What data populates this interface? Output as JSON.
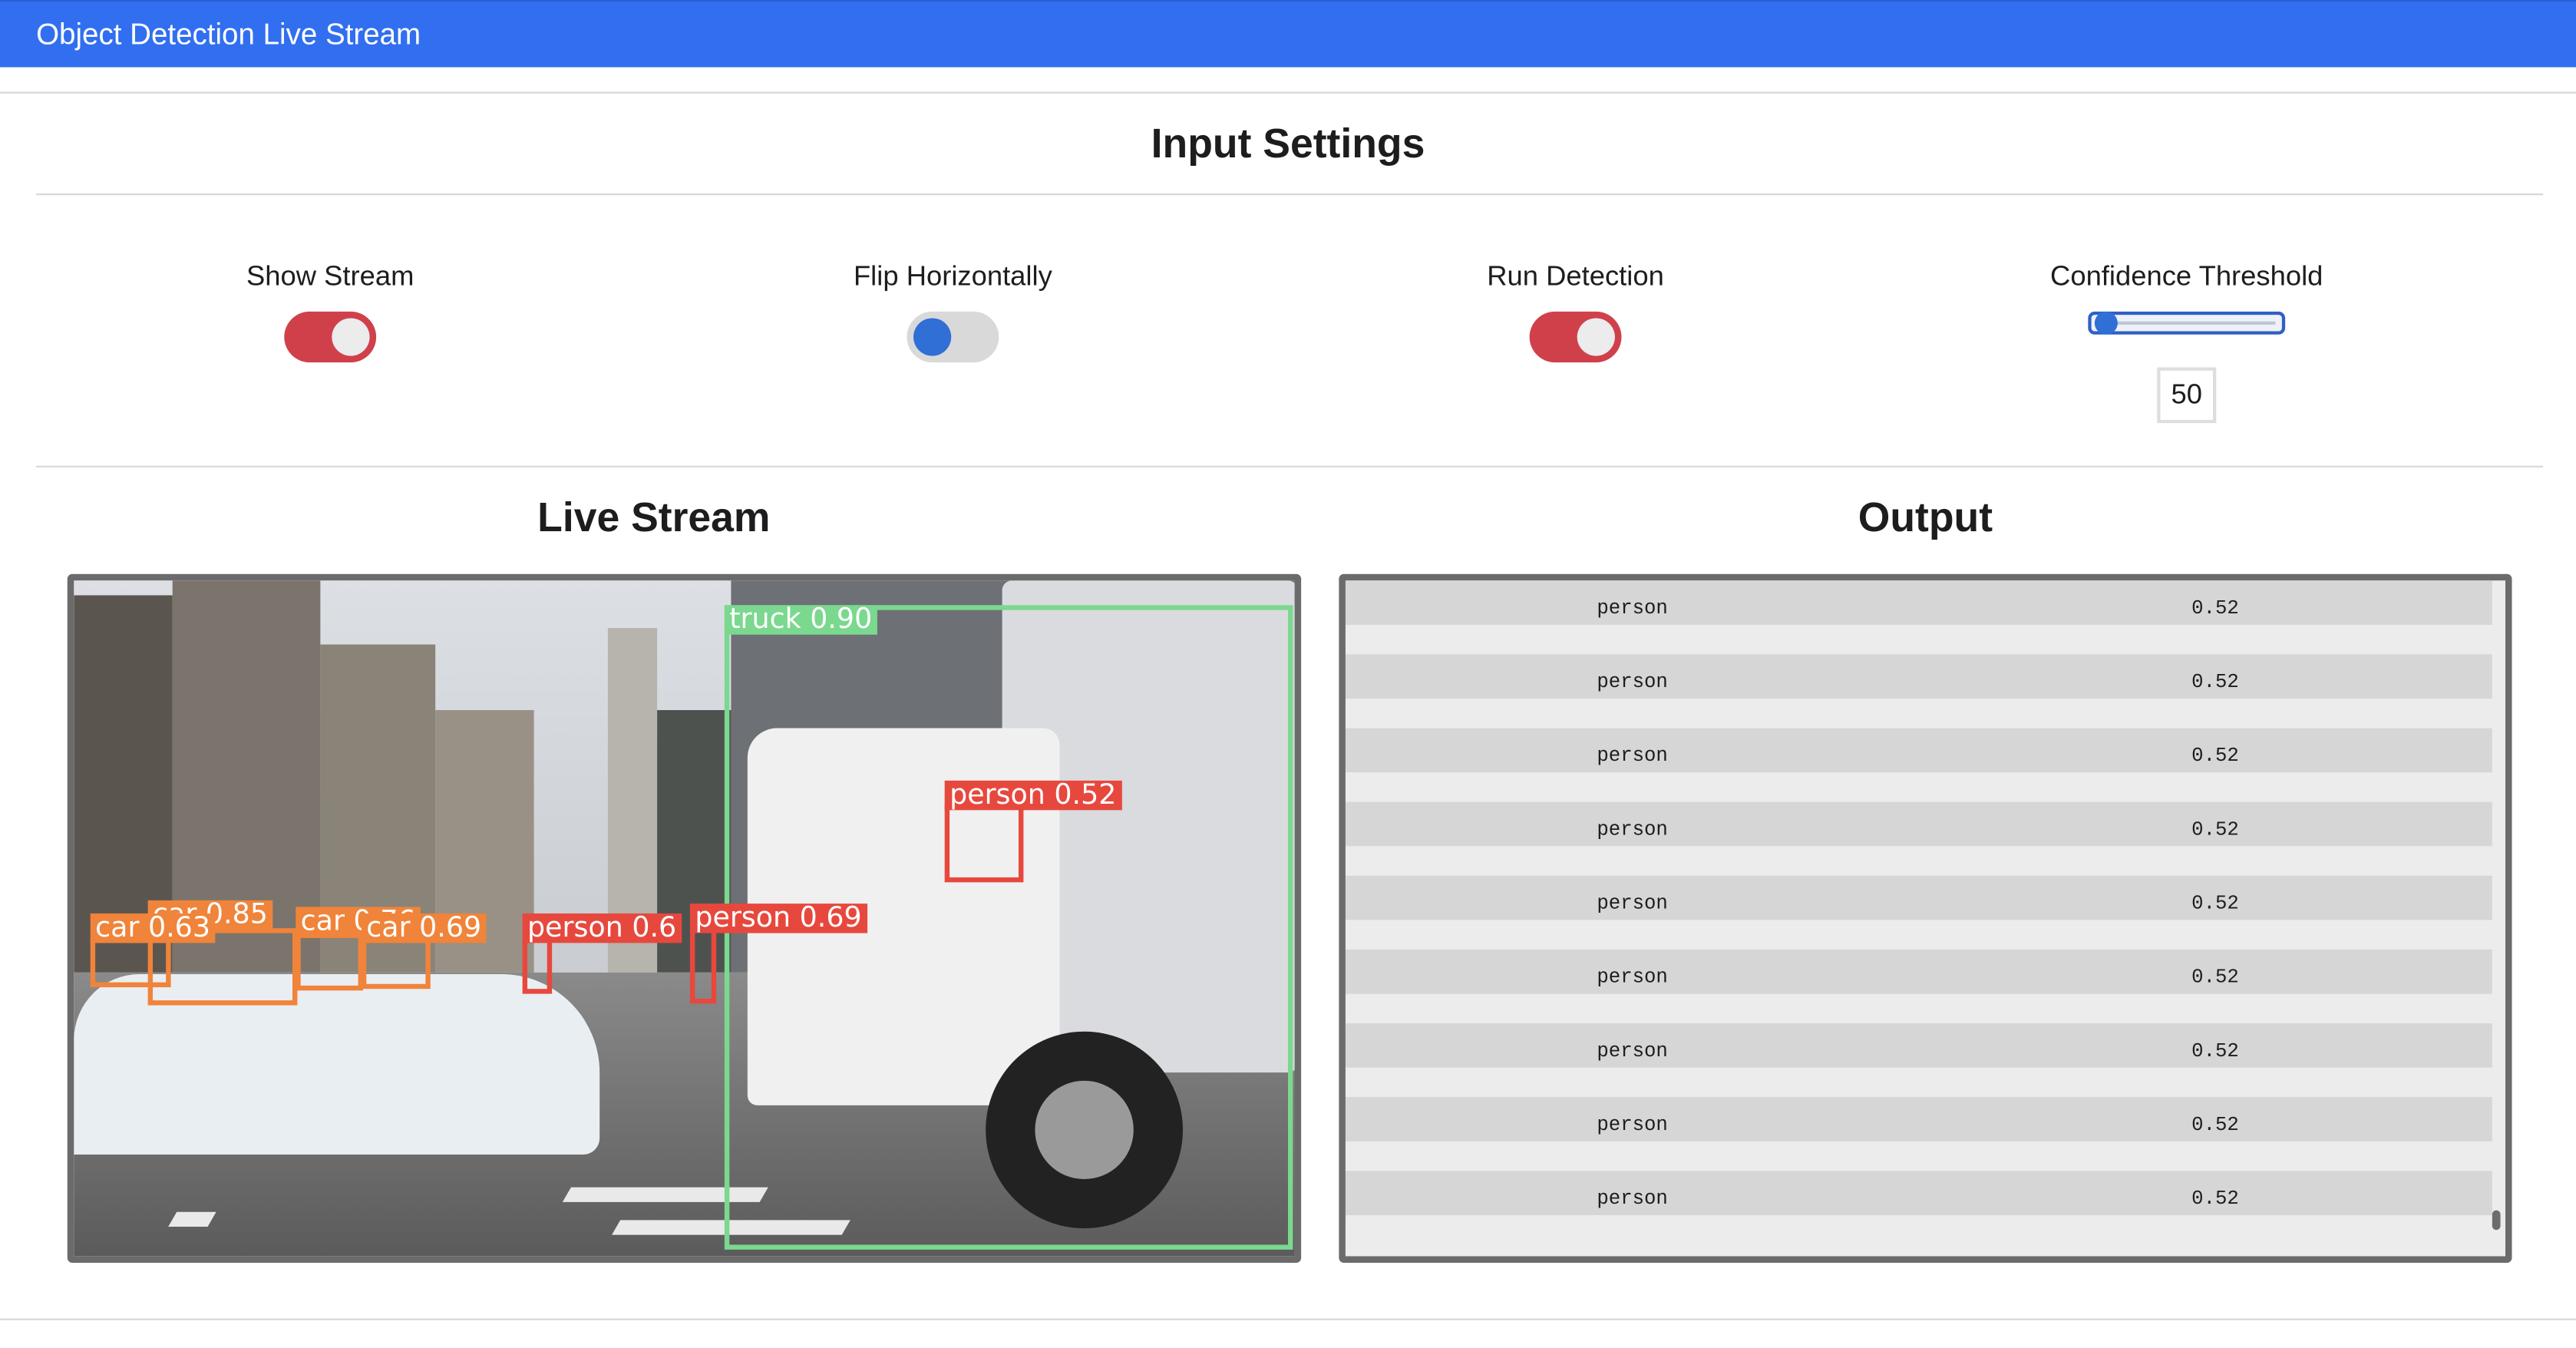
{
  "app": {
    "title": "Object Detection Live Stream"
  },
  "input_settings": {
    "heading": "Input Settings",
    "show_stream": {
      "label": "Show Stream",
      "on": true
    },
    "flip_horizontally": {
      "label": "Flip Horizontally",
      "on": false
    },
    "run_detection": {
      "label": "Run Detection",
      "on": true
    },
    "confidence_threshold": {
      "label": "Confidence Threshold",
      "value": "50"
    }
  },
  "live_stream": {
    "heading": "Live Stream",
    "detections": [
      {
        "label": "truck 0.90",
        "class": "truck"
      },
      {
        "label": "person 0.52",
        "class": "person"
      },
      {
        "label": "person 0.69",
        "class": "person"
      },
      {
        "label": "person 0.6",
        "class": "person"
      },
      {
        "label": "car 0.85",
        "class": "car"
      },
      {
        "label": "car 0.76",
        "class": "car"
      },
      {
        "label": "car 0.69",
        "class": "car"
      },
      {
        "label": "car 0.63",
        "class": "car"
      }
    ]
  },
  "output": {
    "heading": "Output",
    "rows": [
      {
        "class": "person",
        "confidence": "0.52"
      },
      {
        "class": "person",
        "confidence": "0.52"
      },
      {
        "class": "person",
        "confidence": "0.52"
      },
      {
        "class": "person",
        "confidence": "0.52"
      },
      {
        "class": "person",
        "confidence": "0.52"
      },
      {
        "class": "person",
        "confidence": "0.52"
      },
      {
        "class": "person",
        "confidence": "0.52"
      },
      {
        "class": "person",
        "confidence": "0.52"
      },
      {
        "class": "person",
        "confidence": "0.52"
      }
    ]
  },
  "colors": {
    "header": "#316ff0",
    "toggle_on": "#d0404b",
    "toggle_off": "#d9d9d9",
    "truck_box": "#7bd88f",
    "person_box": "#e7483e",
    "car_box": "#f0843a"
  }
}
